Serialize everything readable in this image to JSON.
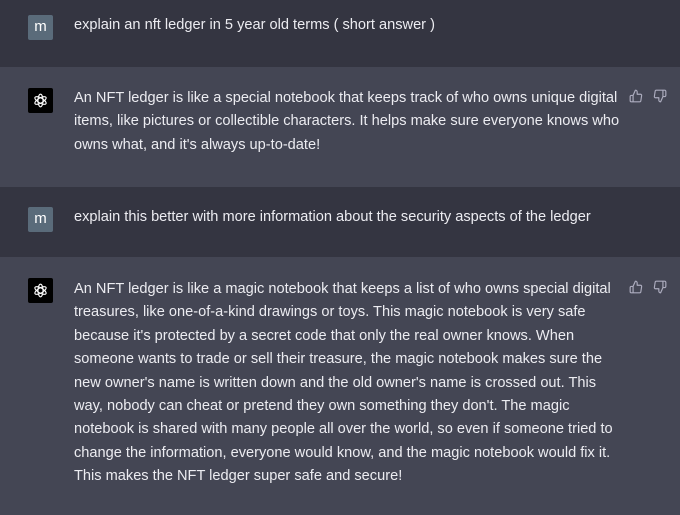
{
  "conversation": {
    "user_avatar_letter": "m",
    "bot_avatar_icon": "openai-logo-icon",
    "messages": [
      {
        "role": "user",
        "text": "explain an nft ledger in 5 year old terms ( short answer )"
      },
      {
        "role": "assistant",
        "text": "An NFT ledger is like a special notebook that keeps track of who owns unique digital items, like pictures or collectible characters. It helps make sure everyone knows who owns what, and it's always up-to-date!"
      },
      {
        "role": "user",
        "text": "explain this better with more information about the security aspects of the ledger"
      },
      {
        "role": "assistant",
        "text": "An NFT ledger is like a magic notebook that keeps a list of who owns special digital treasures, like one-of-a-kind drawings or toys. This magic notebook is very safe because it's protected by a secret code that only the real owner knows. When someone wants to trade or sell their treasure, the magic notebook makes sure the new owner's name is written down and the old owner's name is crossed out. This way, nobody can cheat or pretend they own something they don't. The magic notebook is shared with many people all over the world, so even if someone tried to change the information, everyone would know, and the magic notebook would fix it. This makes the NFT ledger super safe and secure!"
      }
    ],
    "feedback_icons": [
      "thumbs-up-icon",
      "thumbs-down-icon"
    ]
  },
  "colors": {
    "user_background": "#343541",
    "assistant_background": "#444654",
    "text": "#ececf1",
    "icon": "#acacbe",
    "user_avatar_background": "#5a6b7a",
    "bot_avatar_background": "#000000"
  }
}
